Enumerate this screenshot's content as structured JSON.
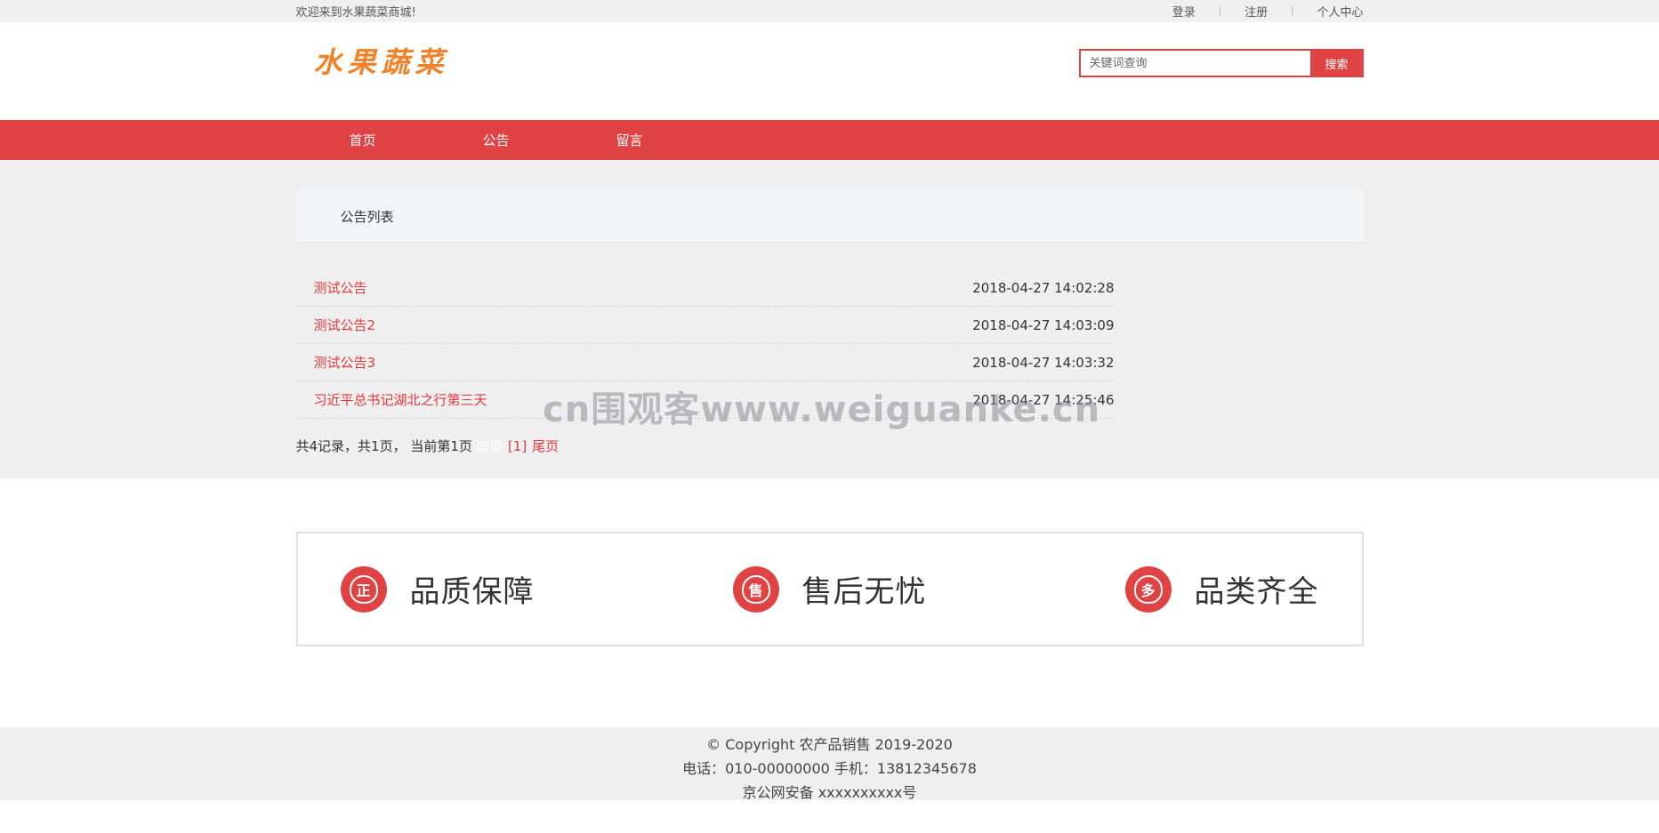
{
  "topbar": {
    "welcome": "欢迎来到水果蔬菜商城!",
    "login": "登录",
    "register": "注册",
    "user_center": "个人中心",
    "separator": "|"
  },
  "header": {
    "logo_text": "水果蔬菜",
    "search_placeholder": "关键词查询",
    "search_button": "搜索"
  },
  "nav": {
    "items": [
      "首页",
      "公告",
      "留言"
    ]
  },
  "notices": {
    "title": "公告列表",
    "rows": [
      {
        "title": "测试公告",
        "time": "2018-04-27 14:02:28"
      },
      {
        "title": "测试公告2",
        "time": "2018-04-27 14:03:09"
      },
      {
        "title": "测试公告3",
        "time": "2018-04-27 14:03:32"
      },
      {
        "title": "习近平总书记湖北之行第三天",
        "time": "2018-04-27 14:25:46"
      }
    ],
    "pager": {
      "summary": "共4记录，共1页， 当前第1页",
      "first": "首页",
      "page": "[1]",
      "last": "尾页"
    }
  },
  "watermark": "cn围观客www.weiguanke.cn",
  "features": [
    {
      "icon": "正",
      "label": "品质保障"
    },
    {
      "icon": "售",
      "label": "售后无忧"
    },
    {
      "icon": "多",
      "label": "品类齐全"
    }
  ],
  "footer": {
    "copyright": "© Copyright 农产品销售 2019-2020",
    "contact": "电话：010-00000000 手机：13812345678",
    "icp": "京公网安备 xxxxxxxxxx号"
  },
  "colors": {
    "accent": "#e04343",
    "link": "#e4393c",
    "logo": "#f0822a"
  }
}
